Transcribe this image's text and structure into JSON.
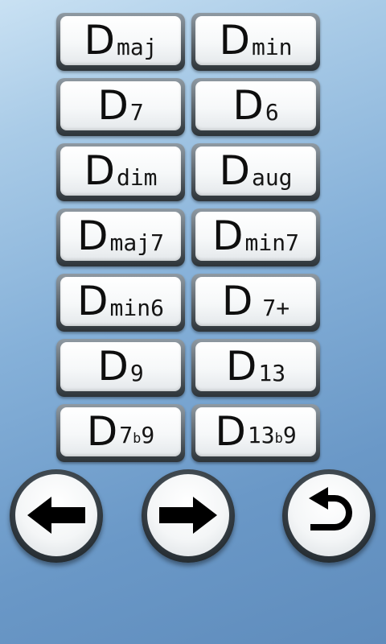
{
  "chords": [
    {
      "root": "D",
      "suffix": "maj"
    },
    {
      "root": "D",
      "suffix": "min"
    },
    {
      "root": "D",
      "suffix": "7"
    },
    {
      "root": "D",
      "suffix": "6"
    },
    {
      "root": "D",
      "suffix": "dim"
    },
    {
      "root": "D",
      "suffix": "aug"
    },
    {
      "root": "D",
      "suffix": "maj7"
    },
    {
      "root": "D",
      "suffix": "min7"
    },
    {
      "root": "D",
      "suffix": "min6"
    },
    {
      "root": "D",
      "suffix": "7+"
    },
    {
      "root": "D",
      "suffix": "9"
    },
    {
      "root": "D",
      "suffix": "13"
    },
    {
      "root": "D",
      "suffix_pre": "7",
      "suffix_flat": "b",
      "suffix_post": "9"
    },
    {
      "root": "D",
      "suffix_pre": "13",
      "suffix_flat": "b",
      "suffix_post": "9"
    }
  ],
  "nav": {
    "prev_icon": "arrow-left-icon",
    "next_icon": "arrow-right-icon",
    "back_icon": "undo-icon"
  },
  "colors": {
    "background_top": "#c9e1f3",
    "background_bottom": "#5f8cbc",
    "button_face": "#ffffff",
    "glyph": "#000000"
  }
}
